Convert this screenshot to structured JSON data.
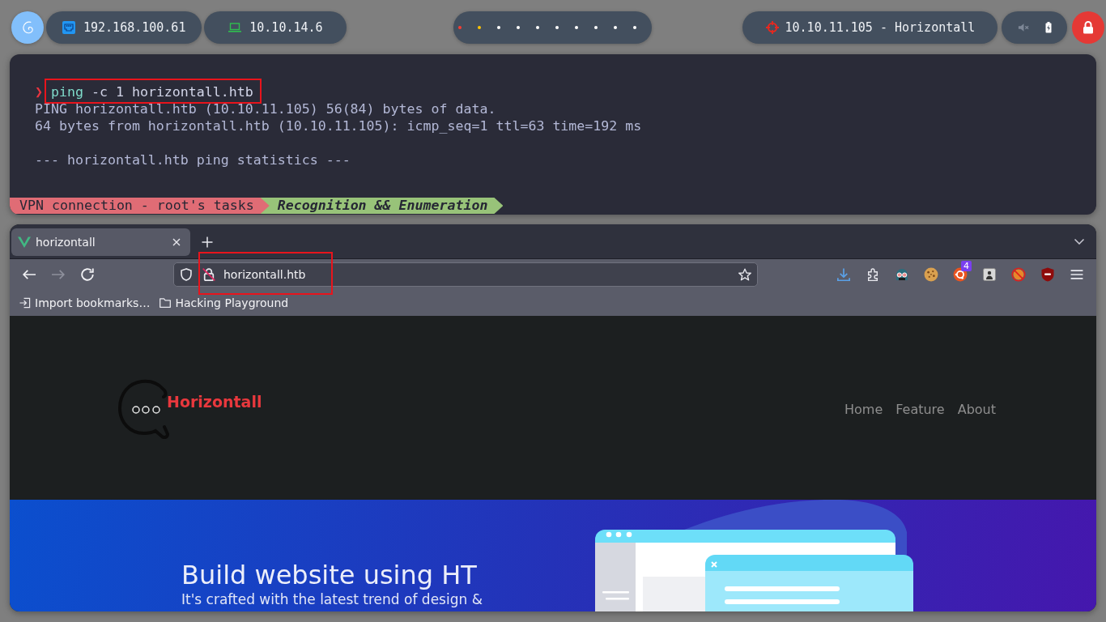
{
  "topbar": {
    "network": [
      {
        "kind": "ethernet",
        "address": "192.168.100.61"
      },
      {
        "kind": "vpn",
        "address": "10.10.14.6"
      }
    ],
    "workspaces": [
      {
        "color": "#ff3b30"
      },
      {
        "color": "#ffc400"
      },
      {
        "color": "#ffffff"
      },
      {
        "color": "#ffffff"
      },
      {
        "color": "#ffffff"
      },
      {
        "color": "#ffffff"
      },
      {
        "color": "#ffffff"
      },
      {
        "color": "#ffffff"
      },
      {
        "color": "#ffffff"
      },
      {
        "color": "#ffffff"
      }
    ],
    "target": "10.10.11.105 - Horizontall",
    "tray": {
      "muted": true
    }
  },
  "terminal": {
    "prompt": "❯",
    "command": {
      "program": "ping",
      "arguments": "-c 1 horizontall.htb",
      "highlighted": true
    },
    "output": [
      {
        "lines": [
          "PING horizontall.htb (10.10.11.105) 56(84) bytes of data.",
          "64 bytes from horizontall.htb (10.10.11.105): icmp_seq=1 ttl=63 time=192 ms"
        ]
      },
      {
        "lines": [
          "--- horizontall.htb ping statistics ---"
        ]
      }
    ],
    "status_line": [
      {
        "text": "VPN connection - root's tasks",
        "color": "#e06c75",
        "emphasis": false
      },
      {
        "text": "Recognition && Enumeration",
        "color": "#98c379",
        "emphasis": true
      }
    ]
  },
  "browser": {
    "tabs": [
      {
        "title": "horizontall",
        "selected": true
      }
    ],
    "navigation": [
      {
        "kind": "back",
        "disabled": false
      },
      {
        "kind": "forward",
        "disabled": true
      },
      {
        "kind": "reload",
        "disabled": false
      }
    ],
    "address": {
      "url": "horizontall.htb",
      "highlighted": true
    },
    "toolbar_icons": [
      {
        "kind": "download"
      },
      {
        "kind": "extensions"
      },
      {
        "kind": "masked-face"
      },
      {
        "kind": "cookie"
      },
      {
        "kind": "ring",
        "badge": "4"
      },
      {
        "kind": "portrait"
      },
      {
        "kind": "blocked"
      },
      {
        "kind": "shield"
      },
      {
        "kind": "menu"
      }
    ],
    "bookmarks": [
      {
        "kind": "import",
        "label": "Import bookmarks…"
      },
      {
        "kind": "folder",
        "label": "Hacking Playground"
      }
    ],
    "page": {
      "brand": "Horizontall",
      "nav": [
        "Home",
        "Feature",
        "About"
      ],
      "hero": {
        "title": "Build website using HT",
        "subtitle": "It's crafted with the latest trend of design &"
      }
    }
  }
}
